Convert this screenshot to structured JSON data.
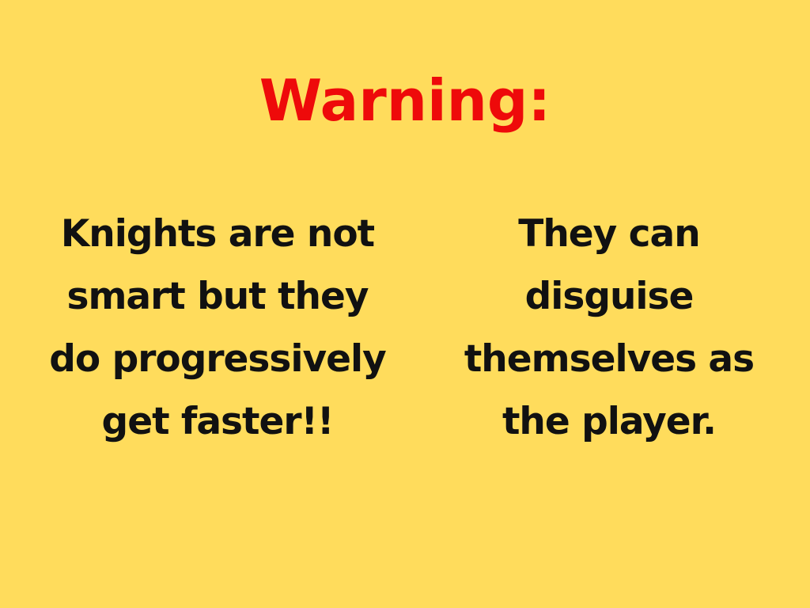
{
  "title": "Warning:",
  "left_text": "Knights are not smart but they do progressively get faster!!",
  "right_text": "They can disguise themselves as the player.",
  "colors": {
    "background": "#FFDC5C",
    "title": "#EE0A0A",
    "text": "#111111"
  }
}
